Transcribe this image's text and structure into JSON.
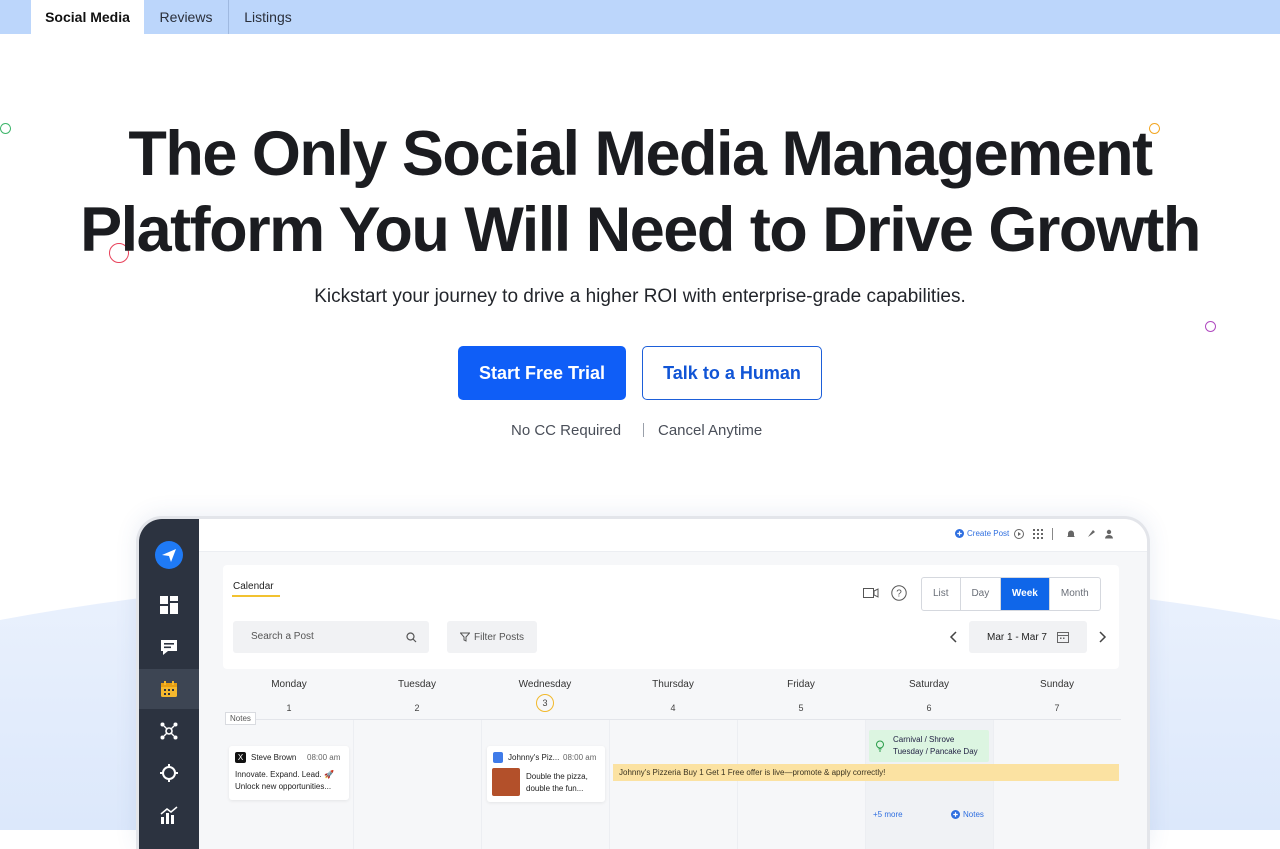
{
  "tabs": [
    {
      "label": "Social Media",
      "active": true
    },
    {
      "label": "Reviews",
      "active": false
    },
    {
      "label": "Listings",
      "active": false
    }
  ],
  "hero": {
    "line1": "The Only Social Media Management",
    "line2": "Platform You Will Need to Drive Growth",
    "subtitle": "Kickstart your journey to drive a higher ROI with enterprise-grade capabilities.",
    "primary_cta": "Start Free Trial",
    "secondary_cta": "Talk to a Human",
    "note_left": "No CC Required",
    "note_right": "Cancel Anytime"
  },
  "colors": {
    "accent": "#0f5ef7",
    "tabbar": "#bcd6fb",
    "sidebar": "#2c3340",
    "week_active": "#0f66e9",
    "banner": "#fbe2a2"
  },
  "app": {
    "create_post": "Create Post",
    "calendar_tab": "Calendar",
    "views": [
      "List",
      "Day",
      "Week",
      "Month"
    ],
    "active_view": "Week",
    "search_placeholder": "Search a Post",
    "filter_label": "Filter Posts",
    "date_range": "Mar 1 - Mar 7",
    "days": [
      {
        "name": "Monday",
        "num": "1"
      },
      {
        "name": "Tuesday",
        "num": "2"
      },
      {
        "name": "Wednesday",
        "num": "3",
        "today": true
      },
      {
        "name": "Thursday",
        "num": "4"
      },
      {
        "name": "Friday",
        "num": "5"
      },
      {
        "name": "Saturday",
        "num": "6"
      },
      {
        "name": "Sunday",
        "num": "7"
      }
    ],
    "notes_tag": "Notes",
    "post1": {
      "author": "Steve Brown",
      "time": "08:00 am",
      "line1": "Innovate. Expand. Lead. 🚀",
      "line2": "Unlock new opportunities..."
    },
    "post2": {
      "author": "Johnny's Piz...",
      "time": "08:00 am",
      "line1": "Double the pizza,",
      "line2": "double the fun..."
    },
    "banner": "Johnny's Pizzeria Buy 1 Get 1 Free offer is live—promote & apply correctly!",
    "holiday_line1": "Carnival / Shrove",
    "holiday_line2": "Tuesday / Pancake Day",
    "more_link": "+5 more",
    "notes_link": "Notes",
    "sidebar_icons": [
      "send-logo-icon",
      "dashboard-icon",
      "comments-icon",
      "calendar-icon",
      "network-icon",
      "target-icon",
      "analytics-icon"
    ]
  }
}
